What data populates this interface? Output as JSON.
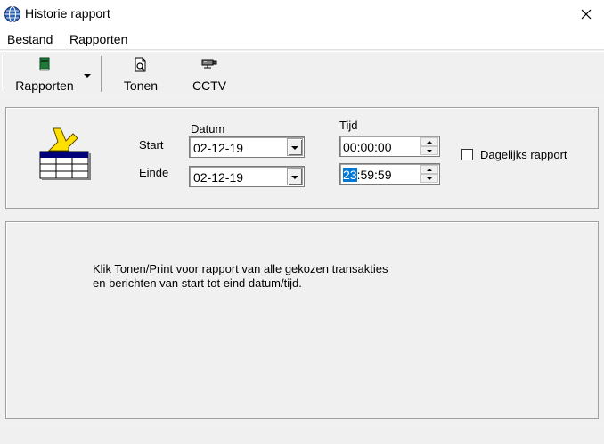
{
  "window": {
    "title": "Historie rapport",
    "icon": "globe-icon",
    "close_icon": "close-icon"
  },
  "menubar": {
    "items": [
      "Bestand",
      "Rapporten"
    ]
  },
  "toolbar": {
    "buttons": [
      {
        "label": "Rapporten",
        "icon": "book-icon",
        "has_dropdown": true
      },
      {
        "label": "Tonen",
        "icon": "print-preview-icon"
      },
      {
        "label": "CCTV",
        "icon": "camera-icon"
      }
    ]
  },
  "filter": {
    "datum_label": "Datum",
    "tijd_label": "Tijd",
    "start_label": "Start",
    "einde_label": "Einde",
    "start_date": "02-12-19",
    "end_date": "02-12-19",
    "start_time": "00:00:00",
    "end_time_selected": "23",
    "end_time_rest": ":59:59",
    "daily_label": "Dagelijks rapport",
    "daily_checked": false
  },
  "main": {
    "message": "Klik Tonen/Print voor rapport van alle gekozen transakties\nen berichten van start tot eind datum/tijd."
  },
  "colors": {
    "selection": "#0078d7",
    "window_bg": "#f0f0f0"
  }
}
